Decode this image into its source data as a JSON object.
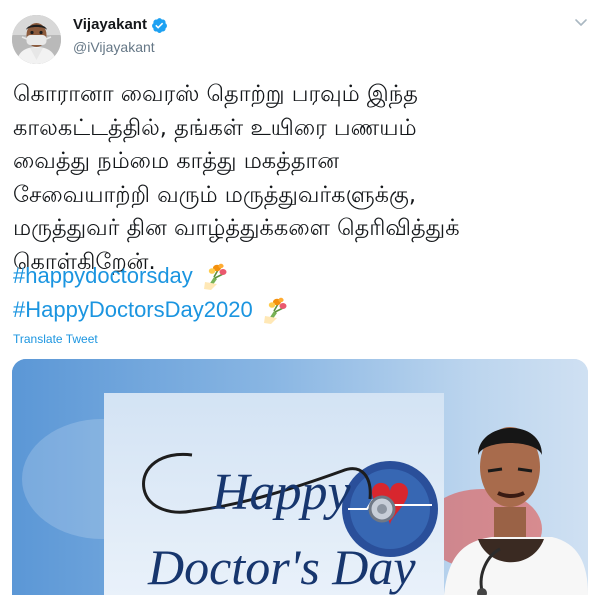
{
  "author": {
    "name": "Vijayakant",
    "handle": "@iVijayakant",
    "verified": true
  },
  "tweet": {
    "lines": [
      "கொரானா வைரஸ் தொற்று பரவும் இந்த",
      "காலகட்டத்தில், தங்கள் உயிரை பணயம்",
      "வைத்து நம்மை காத்து மகத்தான",
      "சேவையாற்றி வரும் மருத்துவர்களுக்கு,",
      "மருத்துவர் தின வாழ்த்துக்களை தெரிவித்துக்",
      "கொள்கிறேன்."
    ],
    "hashtags": [
      "#happydoctorsday",
      "#HappyDoctorsDay2020"
    ],
    "hashtag_icon": "bouquet-emoji",
    "translate_label": "Translate Tweet"
  },
  "media": {
    "title_line1": "Happy",
    "title_line2": "Doctor's Day"
  },
  "colors": {
    "link": "#1b95e0",
    "text": "#14171a",
    "muted": "#657786",
    "verified": "#1da1f2"
  },
  "icons": {
    "verified": "verified-badge-icon",
    "more": "more-chevron-icon"
  }
}
